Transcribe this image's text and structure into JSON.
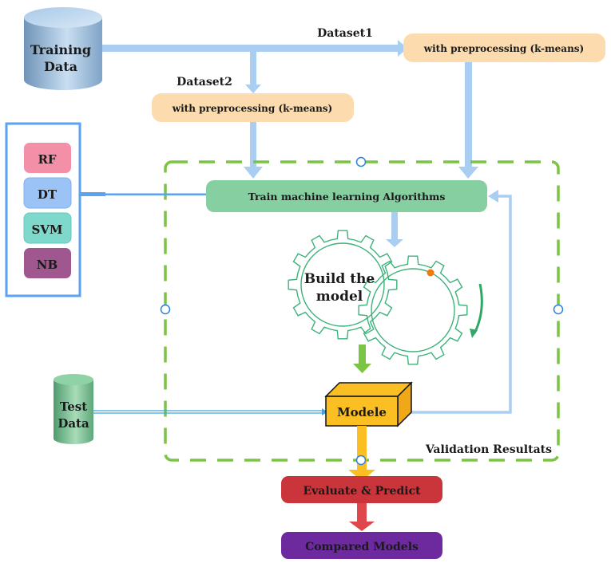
{
  "diagram": {
    "training_data": {
      "line1": "Training",
      "line2": "Data"
    },
    "test_data": {
      "line1": "Test",
      "line2": "Data"
    },
    "dataset1_label": "Dataset1",
    "dataset2_label": "Dataset2",
    "preprocessing1": "with preprocessing (k-means)",
    "preprocessing2": "with preprocessing (k-means)",
    "algorithms": [
      {
        "label": "RF",
        "color": "#f48fa8"
      },
      {
        "label": "DT",
        "color": "#9cc3f5"
      },
      {
        "label": "SVM",
        "color": "#7fd8cc"
      },
      {
        "label": "NB",
        "color": "#a0578f"
      }
    ],
    "train_box": "Train machine learning Algorithms",
    "gears_label": {
      "line1": "Build the",
      "line2": "model"
    },
    "model_box": "Modele",
    "validation_label": "Validation Resultats",
    "evaluate_box": "Evaluate & Predict",
    "compared_box": "Compared Models",
    "colors": {
      "arrow_blue": "#a9cef2",
      "preprocess_fill": "#fcdcae",
      "train_fill": "#86cfa0",
      "dashed_green": "#7cc443",
      "gear_stroke": "#3db27a",
      "model_fill": "#fbbf24",
      "evaluate_fill": "#c9353b",
      "compared_fill": "#6d2a9e",
      "algo_frame": "#5aa2f2"
    }
  }
}
